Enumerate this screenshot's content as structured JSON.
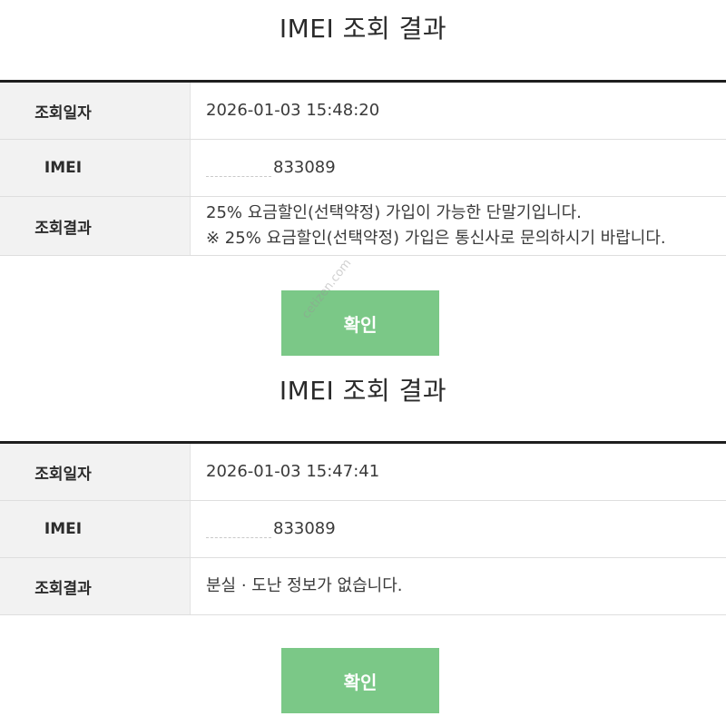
{
  "watermark": "cetizen.com",
  "results": [
    {
      "title": "IMEI 조회 결과",
      "rows": {
        "date_label": "조회일자",
        "date_value": "2026-01-03 15:48:20",
        "imei_label": "IMEI",
        "imei_visible": "833089",
        "result_label": "조회결과",
        "result_lines": [
          "25% 요금할인(선택약정) 가입이 가능한 단말기입니다.",
          "※ 25% 요금할인(선택약정) 가입은 통신사로 문의하시기 바랍니다."
        ]
      },
      "confirm_label": "확인"
    },
    {
      "title": "IMEI 조회 결과",
      "rows": {
        "date_label": "조회일자",
        "date_value": "2026-01-03 15:47:41",
        "imei_label": "IMEI",
        "imei_visible": "833089",
        "result_label": "조회결과",
        "result_lines": [
          "분실 · 도난 정보가 없습니다."
        ]
      },
      "confirm_label": "확인"
    }
  ]
}
